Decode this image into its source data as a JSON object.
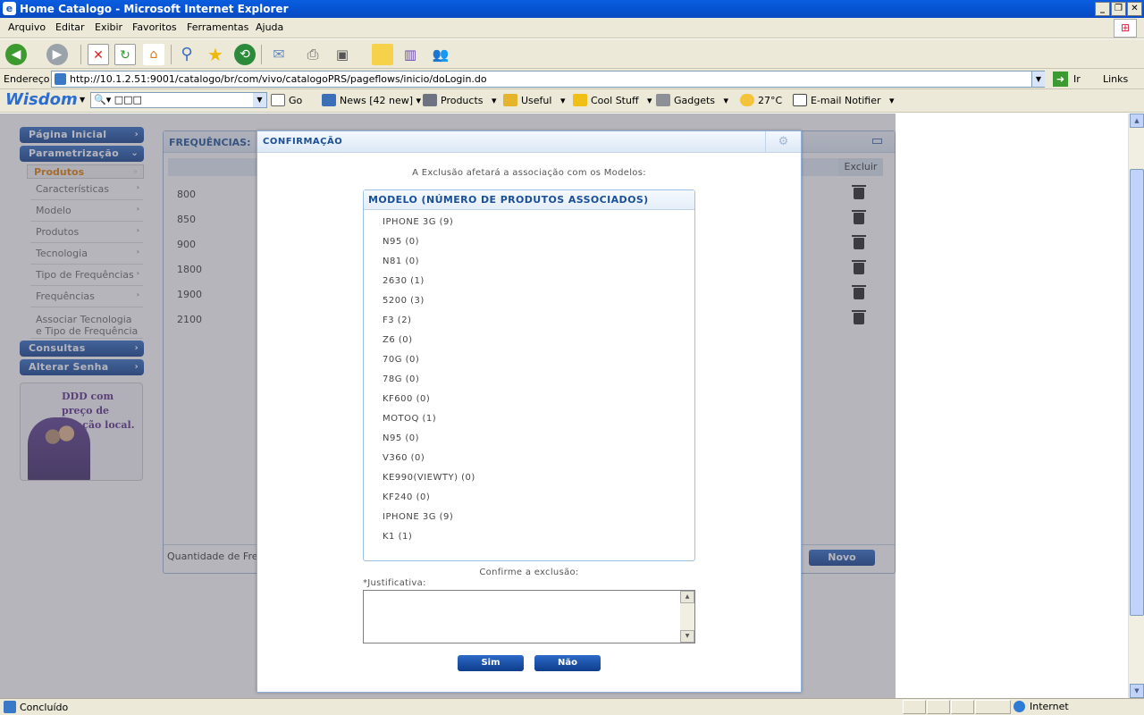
{
  "window": {
    "title": "Home Catalogo - Microsoft Internet Explorer"
  },
  "menubar": [
    "Arquivo",
    "Editar",
    "Exibir",
    "Favoritos",
    "Ferramentas",
    "Ajuda"
  ],
  "address": {
    "label": "Endereço",
    "url": "http://10.1.2.51:9001/catalogo/br/com/vivo/catalogoPRS/pageflows/inicio/doLogin.do",
    "go": "Ir",
    "links": "Links"
  },
  "wisdom": {
    "logo": "Wisdom",
    "search_value": "🔍▾ □□□",
    "go": "Go",
    "news": "News [42 new]",
    "products": "Products",
    "useful": "Useful",
    "cool_stuff": "Cool Stuff",
    "gadgets": "Gadgets",
    "weather": "27°C",
    "email": "E-mail Notifier"
  },
  "leftmenu": {
    "pagina_inicial": "Página Inicial",
    "parametrizacao": "Parametrização",
    "produtos_active": "Produtos",
    "items": [
      "Características",
      "Modelo",
      "Produtos",
      "Tecnologia",
      "Tipo de Frequências",
      "Frequências"
    ],
    "associar_1": "Associar Tecnologia",
    "associar_2": "e Tipo de Frequência",
    "consultas": "Consultas",
    "alterar_senha": "Alterar Senha",
    "banner_text": "DDD com preço de ligação local."
  },
  "panel": {
    "title": "FREQUÊNCIAS:",
    "col_excluir": "Excluir",
    "rows": [
      "800",
      "850",
      "900",
      "1800",
      "1900",
      "2100"
    ],
    "quantity_label": "Quantidade de Fre",
    "novo": "Novo"
  },
  "dialog": {
    "title": "CONFIRMAÇÃO",
    "intro": "A Exclusão afetará a associação com os Modelos:",
    "list_header": "MODELO (NÚMERO DE PRODUTOS ASSOCIADOS)",
    "models": [
      "IPHONE 3G (9)",
      "N95 (0)",
      "N81 (0)",
      "2630 (1)",
      "5200 (3)",
      "F3 (2)",
      "Z6 (0)",
      "70G (0)",
      "78G (0)",
      "KF600 (0)",
      "MOTOQ (1)",
      "N95 (0)",
      "V360 (0)",
      "KE990(VIEWTY) (0)",
      "KF240 (0)",
      "IPHONE 3G (9)",
      "K1 (1)"
    ],
    "confirm": "Confirme a exclusão:",
    "justificativa_label": "*Justificativa:",
    "justificativa_value": "",
    "yes": "Sim",
    "no": "Não"
  },
  "status": {
    "text": "Concluído",
    "zone": "Internet"
  }
}
